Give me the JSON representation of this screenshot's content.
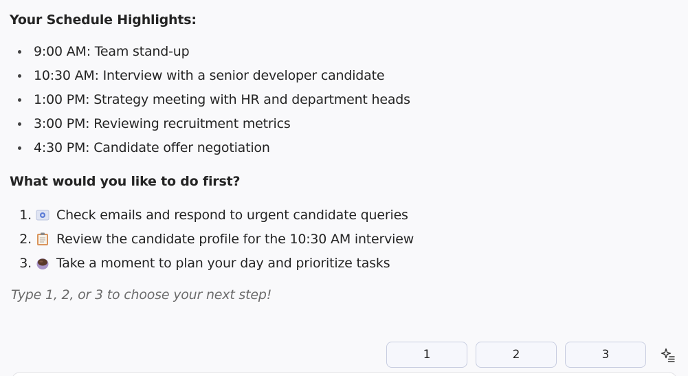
{
  "schedule": {
    "heading": "Your Schedule Highlights:",
    "items": [
      "9:00 AM: Team stand-up",
      "10:30 AM: Interview with a senior developer candidate",
      "1:00 PM: Strategy meeting with HR and department heads",
      "3:00 PM: Reviewing recruitment metrics",
      "4:30 PM: Candidate offer negotiation"
    ]
  },
  "question": {
    "heading": "What would you like to do first?",
    "options": [
      {
        "number": "1.",
        "icon": "email-icon",
        "text": "Check emails and respond to urgent candidate queries"
      },
      {
        "number": "2.",
        "icon": "clipboard-icon",
        "text": "Review the candidate profile for the 10:30 AM interview"
      },
      {
        "number": "3.",
        "icon": "coffee-icon",
        "text": "Take a moment to plan your day and prioritize tasks"
      }
    ]
  },
  "hint": "Type 1, 2, or 3 to choose your next step!",
  "quick_replies": [
    "1",
    "2",
    "3"
  ],
  "sparkle_action": {
    "icon": "sparkle-list-icon"
  }
}
